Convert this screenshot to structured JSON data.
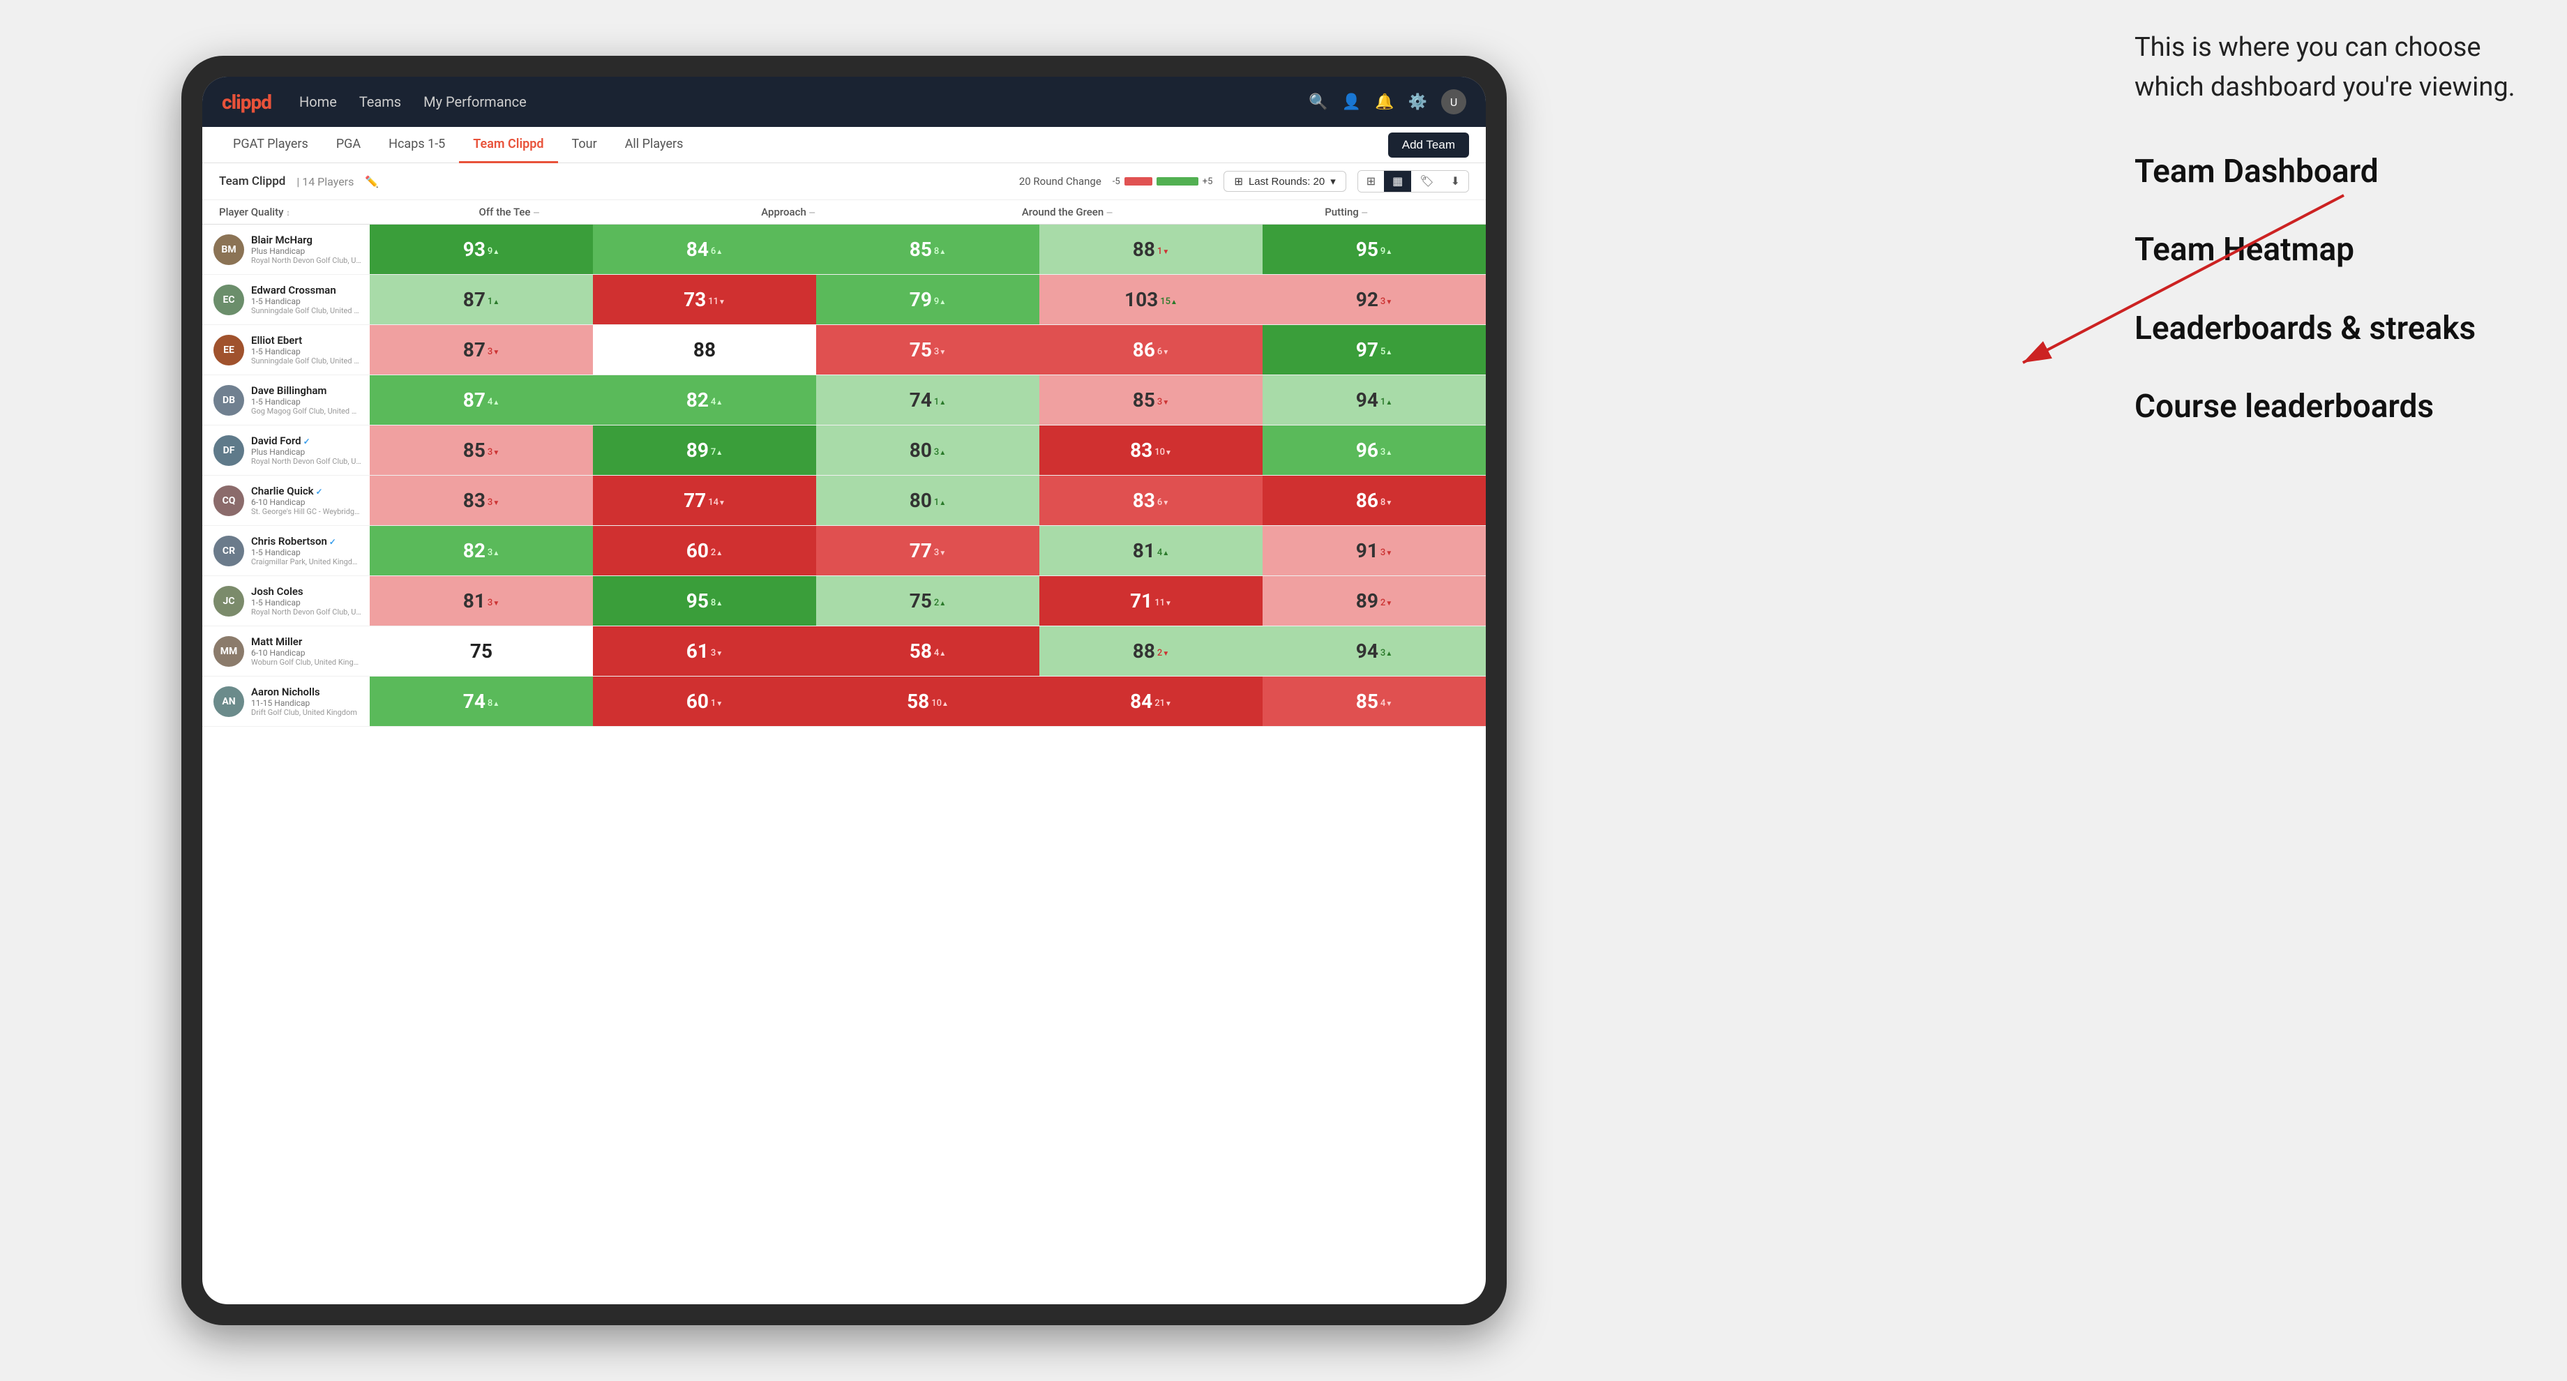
{
  "annotation": {
    "intro_text": "This is where you can choose which dashboard you're viewing.",
    "options": [
      {
        "id": "team-dashboard",
        "label": "Team Dashboard"
      },
      {
        "id": "team-heatmap",
        "label": "Team Heatmap"
      },
      {
        "id": "leaderboards",
        "label": "Leaderboards & streaks"
      },
      {
        "id": "course-leaderboards",
        "label": "Course leaderboards"
      }
    ]
  },
  "navbar": {
    "logo": "clippd",
    "links": [
      {
        "id": "home",
        "label": "Home",
        "active": false
      },
      {
        "id": "teams",
        "label": "Teams",
        "active": false
      },
      {
        "id": "my-performance",
        "label": "My Performance",
        "active": false
      }
    ],
    "icons": [
      "search",
      "user",
      "bell",
      "settings",
      "avatar"
    ]
  },
  "subnav": {
    "tabs": [
      {
        "id": "pgat-players",
        "label": "PGAT Players",
        "active": false
      },
      {
        "id": "pga",
        "label": "PGA",
        "active": false
      },
      {
        "id": "hcaps-1-5",
        "label": "Hcaps 1-5",
        "active": false
      },
      {
        "id": "team-clippd",
        "label": "Team Clippd",
        "active": true
      },
      {
        "id": "tour",
        "label": "Tour",
        "active": false
      },
      {
        "id": "all-players",
        "label": "All Players",
        "active": false
      }
    ],
    "add_team_label": "Add Team"
  },
  "team_header": {
    "name": "Team Clippd",
    "separator": "|",
    "count": "14 Players",
    "round_change_label": "20 Round Change",
    "range_negative": "-5",
    "range_positive": "+5",
    "last_rounds_label": "Last Rounds:",
    "last_rounds_value": "20"
  },
  "table": {
    "col_headers": [
      {
        "id": "player-quality",
        "label": "Player Quality",
        "arrow": "↕"
      },
      {
        "id": "off-the-tee",
        "label": "Off the Tee",
        "arrow": "↕"
      },
      {
        "id": "approach",
        "label": "Approach",
        "arrow": "↕"
      },
      {
        "id": "around-the-green",
        "label": "Around the Green",
        "arrow": "↕"
      },
      {
        "id": "putting",
        "label": "Putting",
        "arrow": "↕"
      }
    ],
    "players": [
      {
        "id": "blair-mcharg",
        "name": "Blair McHarg",
        "handicap": "Plus Handicap",
        "club": "Royal North Devon Golf Club, United Kingdom",
        "avatar_color": "av1",
        "scores": [
          {
            "value": "93",
            "change": "9",
            "dir": "up",
            "color": "cell-green-dark"
          },
          {
            "value": "84",
            "change": "6",
            "dir": "up",
            "color": "cell-green-mid"
          },
          {
            "value": "85",
            "change": "8",
            "dir": "up",
            "color": "cell-green-mid"
          },
          {
            "value": "88",
            "change": "1",
            "dir": "down",
            "color": "cell-green-light"
          },
          {
            "value": "95",
            "change": "9",
            "dir": "up",
            "color": "cell-green-dark"
          }
        ]
      },
      {
        "id": "edward-crossman",
        "name": "Edward Crossman",
        "handicap": "1-5 Handicap",
        "club": "Sunningdale Golf Club, United Kingdom",
        "avatar_color": "av2",
        "scores": [
          {
            "value": "87",
            "change": "1",
            "dir": "up",
            "color": "cell-green-light"
          },
          {
            "value": "73",
            "change": "11",
            "dir": "down",
            "color": "cell-red-dark"
          },
          {
            "value": "79",
            "change": "9",
            "dir": "up",
            "color": "cell-green-mid"
          },
          {
            "value": "103",
            "change": "15",
            "dir": "up",
            "color": "cell-red-light"
          },
          {
            "value": "92",
            "change": "3",
            "dir": "down",
            "color": "cell-red-light"
          }
        ]
      },
      {
        "id": "elliot-ebert",
        "name": "Elliot Ebert",
        "handicap": "1-5 Handicap",
        "club": "Sunningdale Golf Club, United Kingdom",
        "avatar_color": "av3",
        "scores": [
          {
            "value": "87",
            "change": "3",
            "dir": "down",
            "color": "cell-red-light"
          },
          {
            "value": "88",
            "change": "",
            "dir": "none",
            "color": "cell-white"
          },
          {
            "value": "75",
            "change": "3",
            "dir": "down",
            "color": "cell-red-mid"
          },
          {
            "value": "86",
            "change": "6",
            "dir": "down",
            "color": "cell-red-mid"
          },
          {
            "value": "97",
            "change": "5",
            "dir": "up",
            "color": "cell-green-dark"
          }
        ]
      },
      {
        "id": "dave-billingham",
        "name": "Dave Billingham",
        "handicap": "1-5 Handicap",
        "club": "Gog Magog Golf Club, United Kingdom",
        "avatar_color": "av4",
        "scores": [
          {
            "value": "87",
            "change": "4",
            "dir": "up",
            "color": "cell-green-mid"
          },
          {
            "value": "82",
            "change": "4",
            "dir": "up",
            "color": "cell-green-mid"
          },
          {
            "value": "74",
            "change": "1",
            "dir": "up",
            "color": "cell-green-light"
          },
          {
            "value": "85",
            "change": "3",
            "dir": "down",
            "color": "cell-red-light"
          },
          {
            "value": "94",
            "change": "1",
            "dir": "up",
            "color": "cell-green-light"
          }
        ]
      },
      {
        "id": "david-ford",
        "name": "David Ford",
        "handicap": "Plus Handicap",
        "club": "Royal North Devon Golf Club, United Kingdom",
        "avatar_color": "av5",
        "verified": true,
        "scores": [
          {
            "value": "85",
            "change": "3",
            "dir": "down",
            "color": "cell-red-light"
          },
          {
            "value": "89",
            "change": "7",
            "dir": "up",
            "color": "cell-green-dark"
          },
          {
            "value": "80",
            "change": "3",
            "dir": "up",
            "color": "cell-green-light"
          },
          {
            "value": "83",
            "change": "10",
            "dir": "down",
            "color": "cell-red-dark"
          },
          {
            "value": "96",
            "change": "3",
            "dir": "up",
            "color": "cell-green-mid"
          }
        ]
      },
      {
        "id": "charlie-quick",
        "name": "Charlie Quick",
        "handicap": "6-10 Handicap",
        "club": "St. George's Hill GC - Weybridge - Surrey, Uni...",
        "avatar_color": "av6",
        "verified": true,
        "scores": [
          {
            "value": "83",
            "change": "3",
            "dir": "down",
            "color": "cell-red-light"
          },
          {
            "value": "77",
            "change": "14",
            "dir": "down",
            "color": "cell-red-dark"
          },
          {
            "value": "80",
            "change": "1",
            "dir": "up",
            "color": "cell-green-light"
          },
          {
            "value": "83",
            "change": "6",
            "dir": "down",
            "color": "cell-red-mid"
          },
          {
            "value": "86",
            "change": "8",
            "dir": "down",
            "color": "cell-red-dark"
          }
        ]
      },
      {
        "id": "chris-robertson",
        "name": "Chris Robertson",
        "handicap": "1-5 Handicap",
        "club": "Craigmillar Park, United Kingdom",
        "avatar_color": "av7",
        "verified": true,
        "scores": [
          {
            "value": "82",
            "change": "3",
            "dir": "up",
            "color": "cell-green-mid"
          },
          {
            "value": "60",
            "change": "2",
            "dir": "up",
            "color": "cell-red-dark"
          },
          {
            "value": "77",
            "change": "3",
            "dir": "down",
            "color": "cell-red-mid"
          },
          {
            "value": "81",
            "change": "4",
            "dir": "up",
            "color": "cell-green-light"
          },
          {
            "value": "91",
            "change": "3",
            "dir": "down",
            "color": "cell-red-light"
          }
        ]
      },
      {
        "id": "josh-coles",
        "name": "Josh Coles",
        "handicap": "1-5 Handicap",
        "club": "Royal North Devon Golf Club, United Kingdom",
        "avatar_color": "av8",
        "scores": [
          {
            "value": "81",
            "change": "3",
            "dir": "down",
            "color": "cell-red-light"
          },
          {
            "value": "95",
            "change": "8",
            "dir": "up",
            "color": "cell-green-dark"
          },
          {
            "value": "75",
            "change": "2",
            "dir": "up",
            "color": "cell-green-light"
          },
          {
            "value": "71",
            "change": "11",
            "dir": "down",
            "color": "cell-red-dark"
          },
          {
            "value": "89",
            "change": "2",
            "dir": "down",
            "color": "cell-red-light"
          }
        ]
      },
      {
        "id": "matt-miller",
        "name": "Matt Miller",
        "handicap": "6-10 Handicap",
        "club": "Woburn Golf Club, United Kingdom",
        "avatar_color": "av9",
        "scores": [
          {
            "value": "75",
            "change": "",
            "dir": "none",
            "color": "cell-white"
          },
          {
            "value": "61",
            "change": "3",
            "dir": "down",
            "color": "cell-red-dark"
          },
          {
            "value": "58",
            "change": "4",
            "dir": "up",
            "color": "cell-red-dark"
          },
          {
            "value": "88",
            "change": "2",
            "dir": "down",
            "color": "cell-green-light"
          },
          {
            "value": "94",
            "change": "3",
            "dir": "up",
            "color": "cell-green-light"
          }
        ]
      },
      {
        "id": "aaron-nicholls",
        "name": "Aaron Nicholls",
        "handicap": "11-15 Handicap",
        "club": "Drift Golf Club, United Kingdom",
        "avatar_color": "av10",
        "scores": [
          {
            "value": "74",
            "change": "8",
            "dir": "up",
            "color": "cell-green-mid"
          },
          {
            "value": "60",
            "change": "1",
            "dir": "down",
            "color": "cell-red-dark"
          },
          {
            "value": "58",
            "change": "10",
            "dir": "up",
            "color": "cell-red-dark"
          },
          {
            "value": "84",
            "change": "21",
            "dir": "down",
            "color": "cell-red-dark"
          },
          {
            "value": "85",
            "change": "4",
            "dir": "down",
            "color": "cell-red-mid"
          }
        ]
      }
    ]
  }
}
